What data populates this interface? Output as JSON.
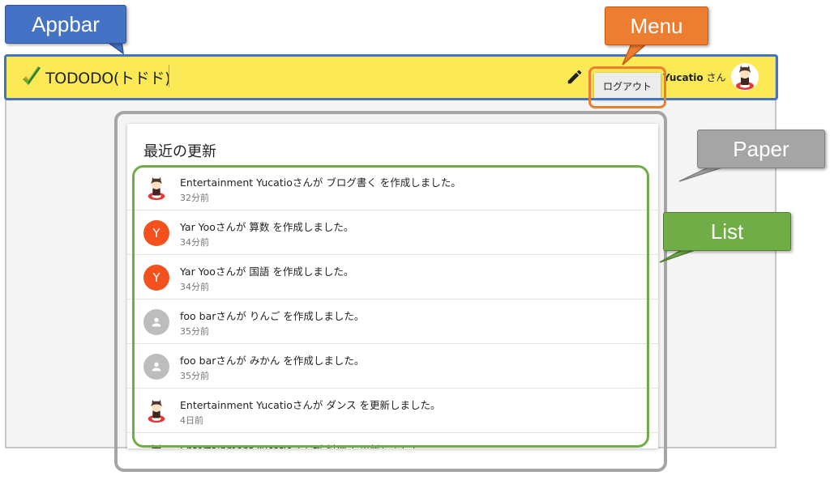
{
  "appbar": {
    "title": "TODODO(トドド)",
    "user_name": "Yucatio",
    "user_suffix": "さん",
    "edit_icon": "pencil-icon"
  },
  "menu": {
    "logout_label": "ログアウト"
  },
  "paper": {
    "title": "最近の更新",
    "items": [
      {
        "text": "Entertainment Yucatioさんが ブログ書く を作成しました。",
        "time": "32分前",
        "avatar": "character"
      },
      {
        "text": "Yar Yooさんが 算数 を作成しました。",
        "time": "34分前",
        "avatar": "letter",
        "letter": "Y"
      },
      {
        "text": "Yar Yooさんが 国語 を作成しました。",
        "time": "34分前",
        "avatar": "letter",
        "letter": "Y"
      },
      {
        "text": "foo barさんが りんご を作成しました。",
        "time": "35分前",
        "avatar": "person-icon"
      },
      {
        "text": "foo barさんが みかん を作成しました。",
        "time": "35分前",
        "avatar": "person-icon"
      },
      {
        "text": "Entertainment Yucatioさんが ダンス を更新しました。",
        "time": "4日前",
        "avatar": "character"
      },
      {
        "text": "Entertainment Yucatioさんが 料理 を更新しました。",
        "time": "",
        "avatar": "character"
      }
    ]
  },
  "annotations": {
    "appbar": "Appbar",
    "menu": "Menu",
    "paper": "Paper",
    "list": "List"
  },
  "colors": {
    "appbar_bg": "#fbea56",
    "letter_avatar": "#f4511e",
    "annot_appbar": "#4472c4",
    "annot_menu": "#ed7d31",
    "annot_paper": "#a5a5a5",
    "annot_list": "#70ad47"
  }
}
